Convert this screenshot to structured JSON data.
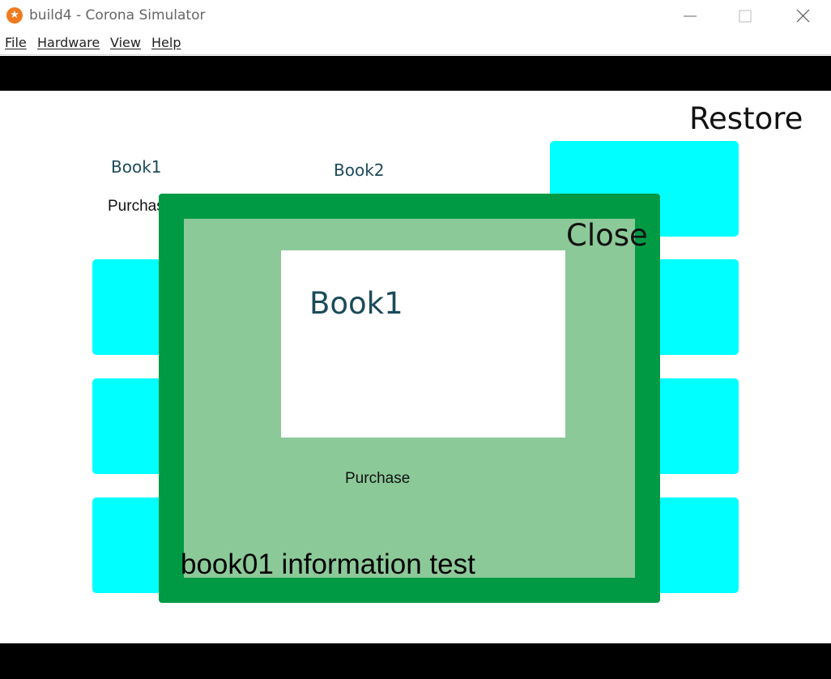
{
  "window": {
    "title": "build4 - Corona Simulator",
    "controls": {
      "minimize": "—",
      "maximize": "☐",
      "close": "✕"
    }
  },
  "menu": {
    "items": [
      {
        "label": "File"
      },
      {
        "label": "Hardware"
      },
      {
        "label": "View"
      },
      {
        "label": "Help"
      }
    ]
  },
  "app": {
    "restore_label": "Restore",
    "book1_label": "Book1",
    "book2_label": "Book2",
    "purchase_label": "Purchas"
  },
  "modal": {
    "close_label": "Close",
    "book_title": "Book1",
    "purchase_label": "Purchase",
    "info_text": "book01 information test"
  },
  "colors": {
    "cyan_tile": "#00ffff",
    "modal_border": "#009a44",
    "modal_fill": "#8cc998",
    "book_text": "#1b4b5a"
  }
}
